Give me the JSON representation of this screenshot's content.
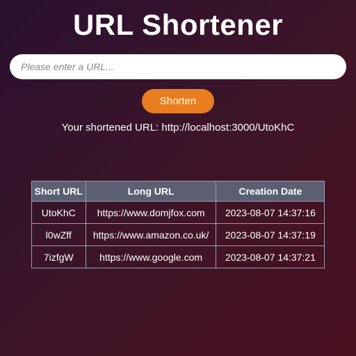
{
  "title": "URL Shortener",
  "input": {
    "placeholder": "Please enter a URL..."
  },
  "shorten_label": "Shorten",
  "result": {
    "prefix": "Your shortened URL: ",
    "url": "http://localhost:3000/UtoKhC"
  },
  "table": {
    "headers": {
      "short": "Short URL",
      "long": "Long URL",
      "date": "Creation Date"
    },
    "rows": [
      {
        "short": "UtoKhC",
        "long": "https://www.domjfox.com",
        "date": "2023-08-07 14:37:16"
      },
      {
        "short": "l0wZff",
        "long": "https://www.amazon.co.uk/",
        "date": "2023-08-07 14:37:19"
      },
      {
        "short": "7izfgW",
        "long": "https://www.google.com",
        "date": "2023-08-07 14:37:21"
      }
    ]
  }
}
